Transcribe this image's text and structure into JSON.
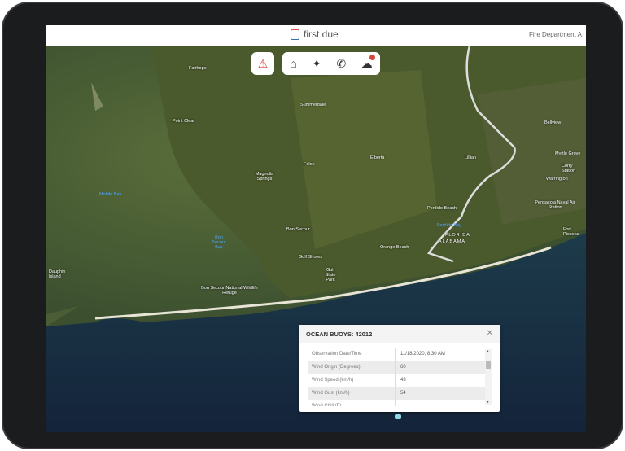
{
  "header": {
    "brand": "first due",
    "department": "Fire Department A"
  },
  "toolbar": {
    "alert_icon": "alarm-bell-icon",
    "items": [
      "home-icon",
      "twitter-icon",
      "phone-icon",
      "weather-alert-icon"
    ]
  },
  "map": {
    "labels": [
      {
        "t": "Fairhope",
        "w": false
      },
      {
        "t": "Point Clear",
        "w": false
      },
      {
        "t": "Mobile Bay",
        "w": true
      },
      {
        "t": "Summerdale",
        "w": false
      },
      {
        "t": "Foley",
        "w": false
      },
      {
        "t": "Magnolia Springs",
        "w": false
      },
      {
        "t": "Elberta",
        "w": false
      },
      {
        "t": "Lillian",
        "w": false
      },
      {
        "t": "Bon Secour",
        "w": false
      },
      {
        "t": "Bon Secour Bay",
        "w": true
      },
      {
        "t": "Gulf Shores",
        "w": false
      },
      {
        "t": "Gulf State Park",
        "w": false
      },
      {
        "t": "Orange Beach",
        "w": false
      },
      {
        "t": "Perdido Beach",
        "w": false
      },
      {
        "t": "Perdido Bay",
        "w": true
      },
      {
        "t": "FLORIDA",
        "w": false
      },
      {
        "t": "ALABAMA",
        "w": false
      },
      {
        "t": "Dauphin Island",
        "w": false
      },
      {
        "t": "Bon Secour National Wildlife Refuge",
        "w": false
      },
      {
        "t": "Bellview",
        "w": false
      },
      {
        "t": "Myrtle Grove",
        "w": false
      },
      {
        "t": "Corry Station",
        "w": false
      },
      {
        "t": "Warrington",
        "w": false
      },
      {
        "t": "Pensacola Naval Air Station",
        "w": false
      },
      {
        "t": "Fort Pickens",
        "w": false
      }
    ]
  },
  "popup": {
    "title": "OCEAN BUOYS: 42012",
    "rows": [
      {
        "k": "Observation Date/Time",
        "v": "11/18/2020, 8:30 AM"
      },
      {
        "k": "Wind Origin (Degrees)",
        "v": "60"
      },
      {
        "k": "Wind Speed (km/h)",
        "v": "43"
      },
      {
        "k": "Wind Gust (km/h)",
        "v": "54"
      },
      {
        "k": "Wind Chill (F)",
        "v": ""
      }
    ]
  }
}
